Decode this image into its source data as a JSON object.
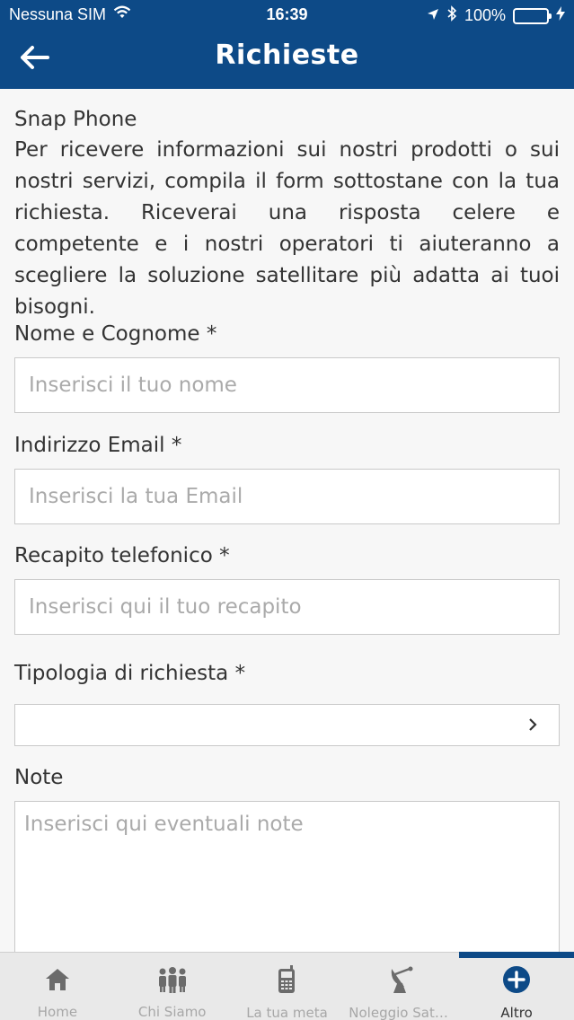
{
  "status": {
    "carrier": "Nessuna SIM",
    "time": "16:39",
    "battery": "100%"
  },
  "header": {
    "title": "Richieste",
    "back_icon": "arrow-left-icon"
  },
  "intro": {
    "title": "Snap Phone",
    "text": "Per ricevere informazioni sui nostri prodotti o sui nostri servizi, compila il form sottostane con la tua richiesta. Riceverai una risposta celere e competente e i nostri operatori ti aiuteranno a scegliere la soluzione satellitare più adatta ai tuoi bisogni."
  },
  "form": {
    "name_label": "Nome e Cognome *",
    "name_placeholder": "Inserisci il tuo nome",
    "email_label": "Indirizzo Email *",
    "email_placeholder": "Inserisci la tua Email",
    "phone_label": "Recapito telefonico *",
    "phone_placeholder": "Inserisci qui il tuo recapito",
    "type_label": "Tipologia di richiesta *",
    "type_value": "",
    "notes_label": "Note",
    "notes_placeholder": "Inserisci qui eventuali note"
  },
  "tabs": [
    {
      "label": "Home",
      "icon": "home-icon"
    },
    {
      "label": "Chi Siamo",
      "icon": "people-icon"
    },
    {
      "label": "La tua meta",
      "icon": "satellite-phone-icon"
    },
    {
      "label": "Noleggio Satel...",
      "icon": "satellite-dish-icon"
    },
    {
      "label": "Altro",
      "icon": "plus-circle-icon",
      "active": true
    }
  ],
  "colors": {
    "primary": "#0d4a87",
    "background": "#f7f7f7",
    "tabbar": "#e9e9e9",
    "battery": "#4cd964"
  }
}
